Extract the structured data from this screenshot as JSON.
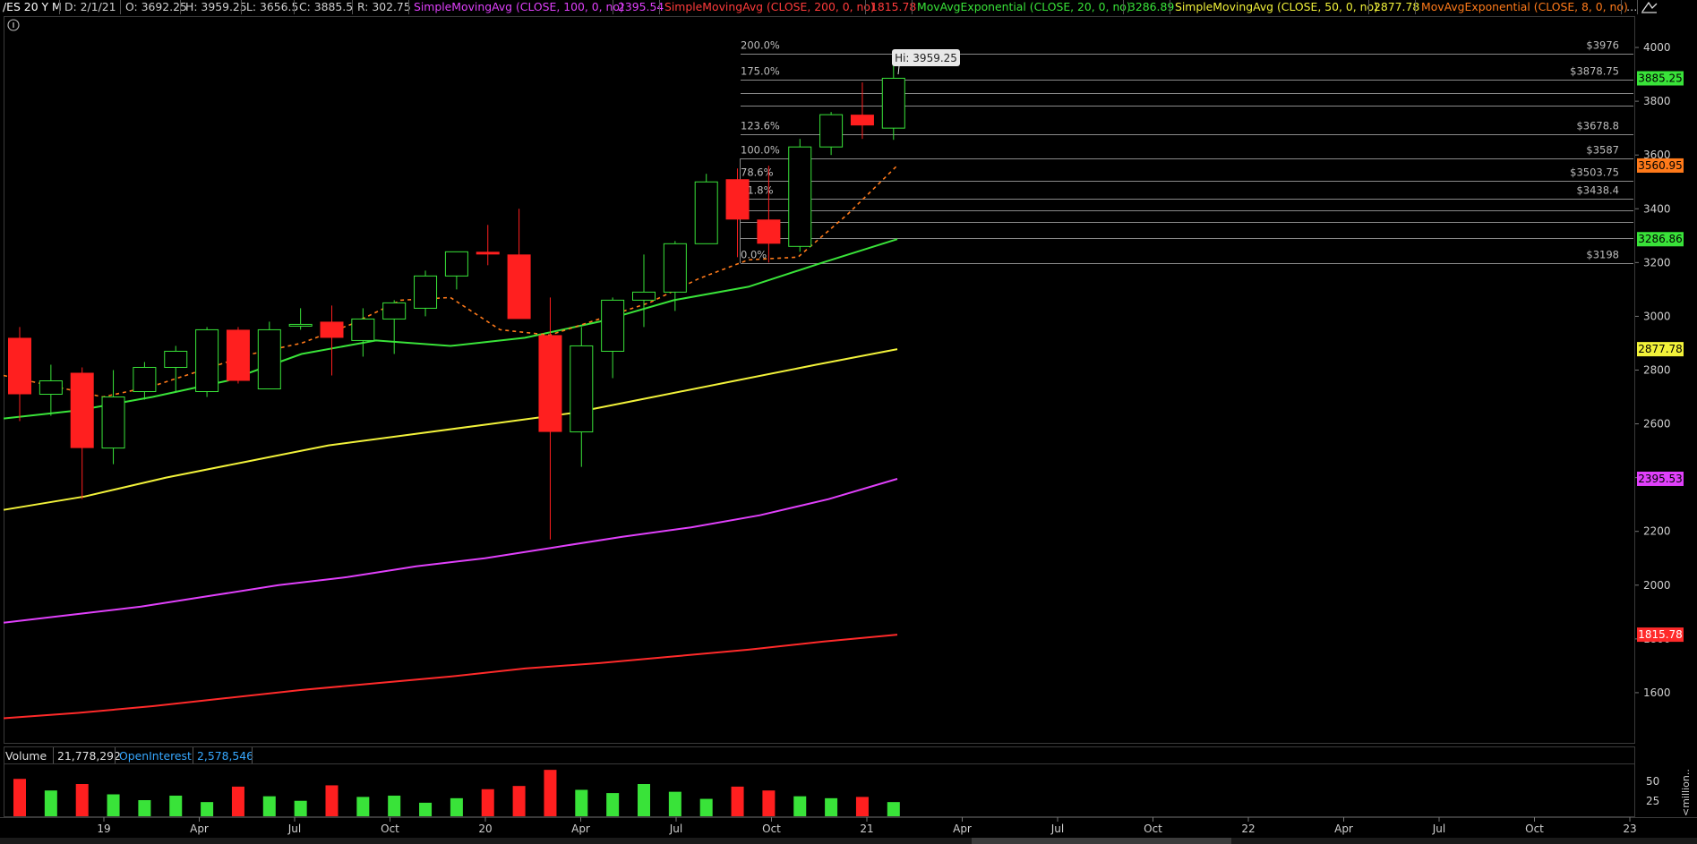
{
  "header": {
    "symbol": "/ES 20 Y M",
    "date": "D: 2/1/21",
    "open": "O: 3692.25",
    "high": "H: 3959.25",
    "low": "L: 3656.5",
    "close": "C: 3885.5",
    "range": "R: 302.75",
    "studies": [
      {
        "label": "SimpleMovingAvg (CLOSE, 100, 0, no)",
        "value": "2395.54",
        "color": "#e040fb"
      },
      {
        "label": "SimpleMovingAvg (CLOSE, 200, 0, no)",
        "value": "1815.78",
        "color": "#ff3b3b"
      },
      {
        "label": "MovAvgExponential (CLOSE, 20, 0, no)",
        "value": "3286.89",
        "color": "#39e339"
      },
      {
        "label": "SimpleMovingAvg (CLOSE, 50, 0, no)",
        "value": "2877.78",
        "color": "#f2f23a"
      },
      {
        "label": "MovAvgExponential (CLOSE, 8, 0, no)",
        "value": "",
        "color": "#ff7a1a"
      }
    ],
    "more": "…"
  },
  "price_badges": [
    {
      "text": "3885.25",
      "value": 3885.25,
      "bg": "#39e339",
      "fg": "#000000"
    },
    {
      "text": "3560.95",
      "value": 3560.95,
      "bg": "#ff7a1a",
      "fg": "#000000"
    },
    {
      "text": "3286.86",
      "value": 3286.86,
      "bg": "#39e339",
      "fg": "#000000"
    },
    {
      "text": "2877.78",
      "value": 2877.78,
      "bg": "#f2f23a",
      "fg": "#000000"
    },
    {
      "text": "2395.53",
      "value": 2395.53,
      "bg": "#e040fb",
      "fg": "#000000"
    },
    {
      "text": "1815.78",
      "value": 1815.78,
      "bg": "#ff2a2a",
      "fg": "#ffffff"
    }
  ],
  "hi_label": "Hi: 3959.25",
  "chart_data": {
    "type": "candlestick",
    "x_ticks": [
      "19",
      "Apr",
      "Jul",
      "Oct",
      "20",
      "Apr",
      "Jul",
      "Oct",
      "21",
      "Apr",
      "Jul",
      "Oct",
      "22",
      "Apr",
      "Jul",
      "Oct",
      "23"
    ],
    "y_ticks": [
      1600,
      1800,
      2000,
      2200,
      2400,
      2600,
      2800,
      3000,
      3200,
      3400,
      3600,
      3800,
      4000
    ],
    "ylim": [
      1420,
      4110
    ],
    "candles": [
      {
        "o": 2920,
        "h": 2960,
        "l": 2610,
        "c": 2710
      },
      {
        "o": 2710,
        "h": 2820,
        "l": 2630,
        "c": 2760
      },
      {
        "o": 2790,
        "h": 2810,
        "l": 2320,
        "c": 2510
      },
      {
        "o": 2510,
        "h": 2800,
        "l": 2450,
        "c": 2700
      },
      {
        "o": 2720,
        "h": 2830,
        "l": 2690,
        "c": 2810
      },
      {
        "o": 2810,
        "h": 2890,
        "l": 2720,
        "c": 2870
      },
      {
        "o": 2720,
        "h": 2960,
        "l": 2700,
        "c": 2950
      },
      {
        "o": 2950,
        "h": 2960,
        "l": 2750,
        "c": 2760
      },
      {
        "o": 2730,
        "h": 2980,
        "l": 2730,
        "c": 2950
      },
      {
        "o": 2970,
        "h": 3030,
        "l": 2950,
        "c": 2970
      },
      {
        "o": 2980,
        "h": 3040,
        "l": 2780,
        "c": 2920
      },
      {
        "o": 2910,
        "h": 3030,
        "l": 2850,
        "c": 2990
      },
      {
        "o": 2990,
        "h": 3060,
        "l": 2860,
        "c": 3050
      },
      {
        "o": 3030,
        "h": 3170,
        "l": 3000,
        "c": 3150
      },
      {
        "o": 3150,
        "h": 3240,
        "l": 3100,
        "c": 3240
      },
      {
        "o": 3240,
        "h": 3340,
        "l": 3190,
        "c": 3230
      },
      {
        "o": 3230,
        "h": 3400,
        "l": 3030,
        "c": 2990
      },
      {
        "o": 2930,
        "h": 3070,
        "l": 2170,
        "c": 2570
      },
      {
        "o": 2570,
        "h": 2960,
        "l": 2440,
        "c": 2890
      },
      {
        "o": 2870,
        "h": 3070,
        "l": 2770,
        "c": 3060
      },
      {
        "o": 3060,
        "h": 3230,
        "l": 2960,
        "c": 3090
      },
      {
        "o": 3090,
        "h": 3280,
        "l": 3020,
        "c": 3270
      },
      {
        "o": 3270,
        "h": 3530,
        "l": 3270,
        "c": 3500
      },
      {
        "o": 3510,
        "h": 3550,
        "l": 3220,
        "c": 3360
      },
      {
        "o": 3360,
        "h": 3560,
        "l": 3200,
        "c": 3270
      },
      {
        "o": 3260,
        "h": 3660,
        "l": 3240,
        "c": 3630
      },
      {
        "o": 3630,
        "h": 3760,
        "l": 3600,
        "c": 3750
      },
      {
        "o": 3750,
        "h": 3870,
        "l": 3660,
        "c": 3710
      },
      {
        "o": 3700,
        "h": 3959.25,
        "l": 3656.5,
        "c": 3885.5
      }
    ],
    "series": [
      {
        "name": "SimpleMovingAvg (CLOSE, 100, 0, no)",
        "color": "#e040fb",
        "dashed": false,
        "values": [
          1860,
          1890,
          1920,
          1960,
          2000,
          2030,
          2070,
          2100,
          2140,
          2180,
          2215,
          2260,
          2320,
          2395.54
        ]
      },
      {
        "name": "SimpleMovingAvg (CLOSE, 200, 0, no)",
        "color": "#ff2a2a",
        "dashed": false,
        "values": [
          1505,
          1525,
          1550,
          1580,
          1610,
          1635,
          1660,
          1690,
          1710,
          1735,
          1760,
          1790,
          1815.78
        ]
      },
      {
        "name": "MovAvgExponential (CLOSE, 20, 0, no)",
        "color": "#39e339",
        "dashed": false,
        "values": [
          2620,
          2650,
          2700,
          2760,
          2860,
          2910,
          2890,
          2920,
          2980,
          3060,
          3110,
          3200,
          3286.89
        ]
      },
      {
        "name": "SimpleMovingAvg (CLOSE, 50, 0, no)",
        "color": "#f2f23a",
        "dashed": false,
        "values": [
          2280,
          2330,
          2400,
          2460,
          2520,
          2560,
          2600,
          2640,
          2700,
          2760,
          2820,
          2877.78
        ]
      },
      {
        "name": "MovAvgExponential (CLOSE, 8, 0, no)",
        "color": "#ff7a1a",
        "dashed": true,
        "values": [
          2780,
          2740,
          2700,
          2740,
          2800,
          2860,
          2900,
          2970,
          3060,
          3070,
          2950,
          2930,
          2990,
          3050,
          3140,
          3210,
          3220,
          3380,
          3560.95
        ]
      }
    ],
    "fib_levels": [
      {
        "pct": "200.0%",
        "price": "$3976",
        "value": 3976
      },
      {
        "pct": "175.0%",
        "price": "$3878.75",
        "value": 3878.75
      },
      {
        "pct": "",
        "price": "",
        "value": 3830
      },
      {
        "pct": "",
        "price": "",
        "value": 3785
      },
      {
        "pct": "123.6%",
        "price": "$3678.8",
        "value": 3678.8
      },
      {
        "pct": "100.0%",
        "price": "$3587",
        "value": 3587
      },
      {
        "pct": "78.6%",
        "price": "$3503.75",
        "value": 3503.75
      },
      {
        "pct": "61.8%",
        "price": "$3438.4",
        "value": 3438.4
      },
      {
        "pct": "",
        "price": "",
        "value": 3395
      },
      {
        "pct": "",
        "price": "",
        "value": 3350
      },
      {
        "pct": "",
        "price": "",
        "value": 3290
      },
      {
        "pct": "0.0%",
        "price": "$3198",
        "value": 3198
      }
    ]
  },
  "volume_panel": {
    "label": "Volume",
    "volume": "21,778,292",
    "oi_label": "OpenInterest",
    "oi": "2,578,546",
    "y_ticks": [
      "50",
      "25"
    ],
    "unit": "<million..",
    "bars": [
      {
        "v": 58,
        "up": false
      },
      {
        "v": 40,
        "up": true
      },
      {
        "v": 50,
        "up": false
      },
      {
        "v": 34,
        "up": true
      },
      {
        "v": 25,
        "up": true
      },
      {
        "v": 32,
        "up": true
      },
      {
        "v": 22,
        "up": true
      },
      {
        "v": 46,
        "up": false
      },
      {
        "v": 31,
        "up": true
      },
      {
        "v": 24,
        "up": true
      },
      {
        "v": 48,
        "up": false
      },
      {
        "v": 30,
        "up": true
      },
      {
        "v": 32,
        "up": true
      },
      {
        "v": 21,
        "up": true
      },
      {
        "v": 28,
        "up": true
      },
      {
        "v": 42,
        "up": false
      },
      {
        "v": 47,
        "up": false
      },
      {
        "v": 72,
        "up": false
      },
      {
        "v": 41,
        "up": true
      },
      {
        "v": 36,
        "up": true
      },
      {
        "v": 50,
        "up": true
      },
      {
        "v": 38,
        "up": true
      },
      {
        "v": 27,
        "up": true
      },
      {
        "v": 46,
        "up": false
      },
      {
        "v": 40,
        "up": false
      },
      {
        "v": 31,
        "up": true
      },
      {
        "v": 28,
        "up": true
      },
      {
        "v": 30,
        "up": false
      },
      {
        "v": 22,
        "up": true
      }
    ]
  }
}
